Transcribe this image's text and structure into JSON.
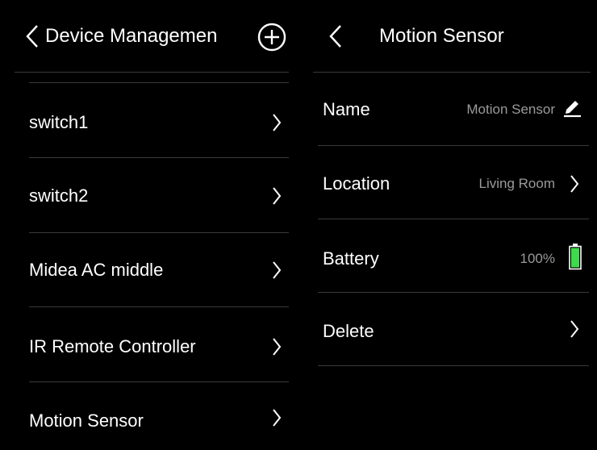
{
  "left": {
    "title": "Device Managemen",
    "items": [
      {
        "label": "switch1"
      },
      {
        "label": "switch2"
      },
      {
        "label": "Midea AC middle"
      },
      {
        "label": "IR Remote Controller"
      },
      {
        "label": "Motion Sensor"
      }
    ]
  },
  "right": {
    "title": "Motion Sensor",
    "name_label": "Name",
    "name_value": "Motion Sensor",
    "location_label": "Location",
    "location_value": "Living Room",
    "battery_label": "Battery",
    "battery_value": "100%",
    "battery_level": 1.0,
    "delete_label": "Delete"
  },
  "colors": {
    "background": "#000000",
    "text": "#ffffff",
    "secondary_text": "#9a9a9a",
    "divider": "#3a3a3a",
    "battery": "#3ddc4a"
  },
  "icons": [
    "chevron-left-icon",
    "plus-circle-icon",
    "chevron-right-icon",
    "edit-pencil-icon",
    "battery-icon"
  ]
}
